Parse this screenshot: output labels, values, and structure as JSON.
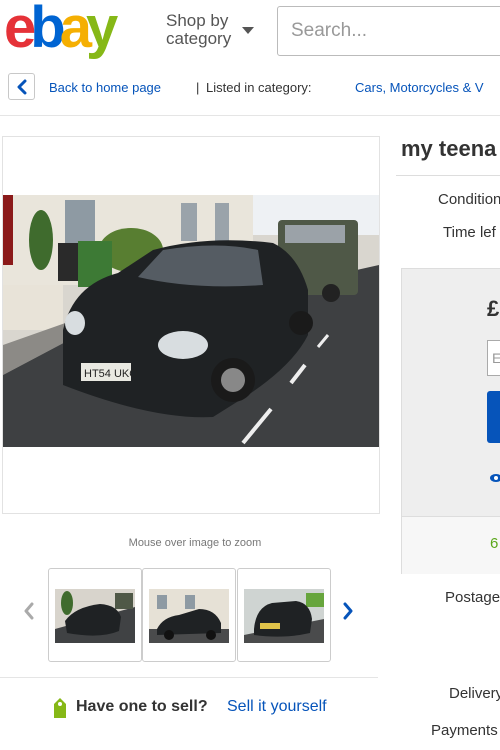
{
  "header": {
    "logo": [
      "e",
      "b",
      "a",
      "y"
    ],
    "logo_colors": [
      "#e53238",
      "#0064d2",
      "#f5af02",
      "#86b817"
    ],
    "shop_by_line1": "Shop by",
    "shop_by_line2": "category",
    "search_placeholder": "Search..."
  },
  "breadcrumb": {
    "back_label": "Back to home page",
    "separator": "|",
    "listed_in": "Listed in category:",
    "category": "Cars, Motorcycles & V"
  },
  "gallery": {
    "zoom_hint": "Mouse over image to zoom",
    "thumbnail_count": 3
  },
  "sell_prompt": {
    "question": "Have one to sell?",
    "link": "Sell it yourself"
  },
  "listing": {
    "title": "my teena",
    "condition_label": "Condition",
    "time_left_label": "Time lef",
    "price": "£",
    "bid_placeholder": "E",
    "bids_count": "6",
    "postage_label": "Postage",
    "delivery_label": "Delivery",
    "payments_label": "Payments"
  },
  "colors": {
    "link": "#0654ba",
    "bid_button": "#0654ba",
    "bids_green": "#5ba71b"
  }
}
